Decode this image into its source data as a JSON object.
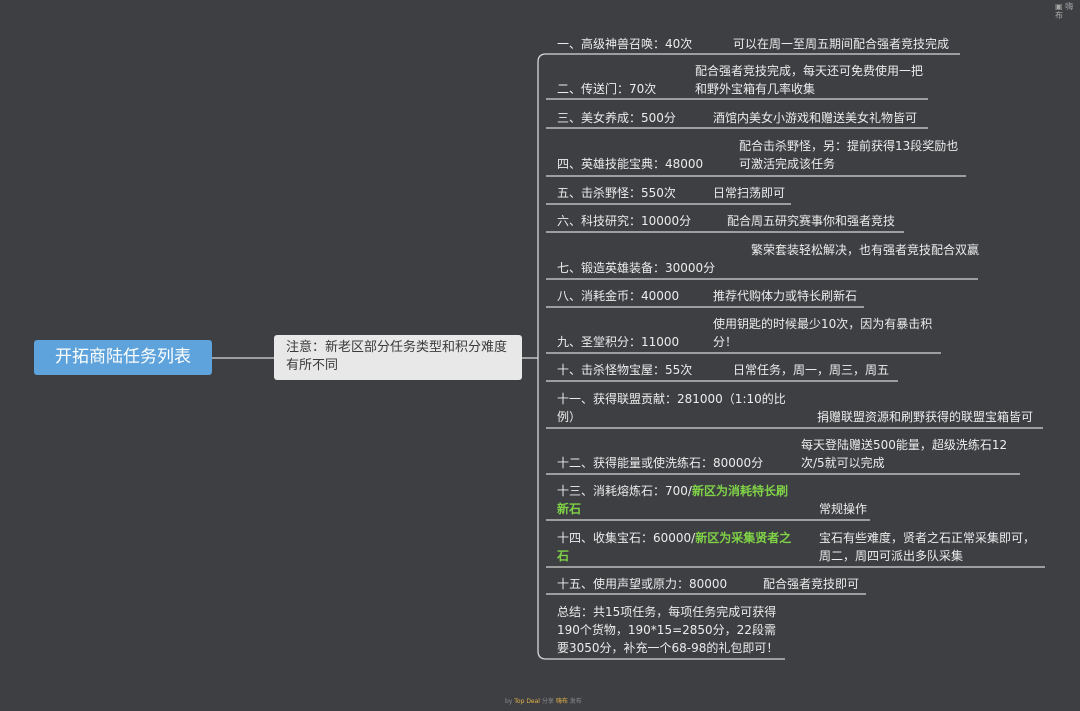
{
  "root": {
    "title": "开拓商陆任务列表"
  },
  "note": {
    "text": "注意：新老区部分任务类型和积分难度有所不同"
  },
  "tasks": [
    {
      "label": "一、高级神兽召唤：40次",
      "desc": "可以在周一至周五期间配合强者竞技完成"
    },
    {
      "label": "二、传送门：70次",
      "desc": "配合强者竞技完成，每天还可免费使用一把和野外宝箱有几率收集"
    },
    {
      "label": "三、美女养成：500分",
      "desc": "酒馆内美女小游戏和赠送美女礼物皆可"
    },
    {
      "label": "四、英雄技能宝典：48000",
      "desc": "配合击杀野怪，另：提前获得13段奖励也可激活完成该任务"
    },
    {
      "label": "五、击杀野怪：550次",
      "desc": "日常扫荡即可"
    },
    {
      "label": "六、科技研究：10000分",
      "desc": "配合周五研究赛事你和强者竞技"
    },
    {
      "label": "七、锻造英雄装备：30000分",
      "desc": "繁荣套装轻松解决，也有强者竞技配合双赢"
    },
    {
      "label": "八、消耗金币：40000",
      "desc": "推荐代购体力或特长刷新石"
    },
    {
      "label": "九、圣堂积分：11000",
      "desc": "使用钥匙的时候最少10次，因为有暴击积分！"
    },
    {
      "label": "十、击杀怪物宝屋：55次",
      "desc": "日常任务，周一，周三，周五"
    },
    {
      "label": "十一、获得联盟贡献：281000（1:10的比例）",
      "desc": "捐赠联盟资源和刷野获得的联盟宝箱皆可"
    },
    {
      "label": "十二、获得能量或使洗练石：80000分",
      "desc": "每天登陆赠送500能量，超级洗练石12次/5就可以完成"
    },
    {
      "label": "十三、消耗熔炼石：700/",
      "highlight": "新区为消耗特长刷新石",
      "desc": "常规操作"
    },
    {
      "label": "十四、收集宝石：60000/",
      "highlight": "新区为采集贤者之石",
      "desc": "宝石有些难度，贤者之石正常采集即可，周二，周四可派出多队采集"
    },
    {
      "label": "十五、使用声望或原力：80000",
      "desc": "配合强者竞技即可"
    }
  ],
  "summary": {
    "text": "总结：共15项任务，每项任务完成可获得190个货物，190*15=2850分，22段需要3050分，补充一个68-98的礼包即可！"
  },
  "footer": {
    "prefix": "by",
    "brand": "Top Deal",
    "middle": "分享",
    "brand2": "嗨布",
    "suffix": "发布"
  },
  "top_icon": {
    "label": "嗨布",
    "icon": "share-icon"
  },
  "colors": {
    "background": "#3d3f43",
    "root": "#5ea3db",
    "line": "#d8d8d8",
    "highlight": "#7fd146"
  }
}
